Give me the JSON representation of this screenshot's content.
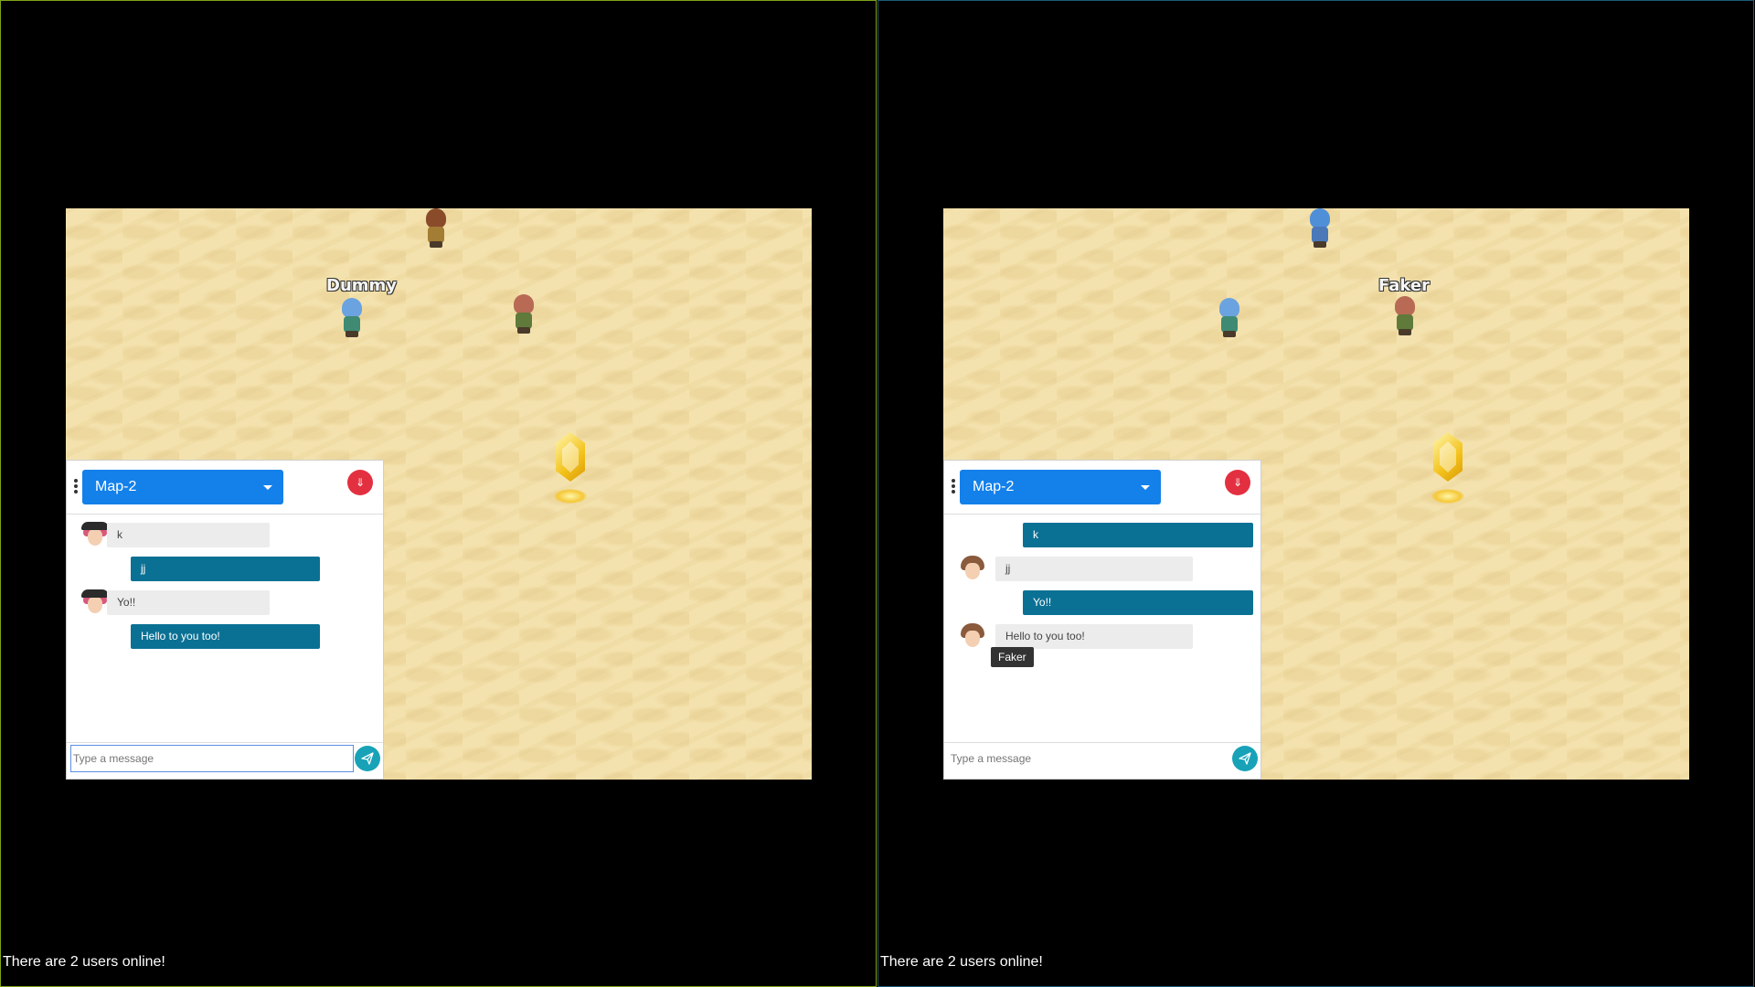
{
  "panes": [
    {
      "id": "left",
      "players": [
        {
          "name": "",
          "sprite": "brown-hair-warrior"
        },
        {
          "name": "Dummy",
          "sprite": "blue-hair-girl"
        },
        {
          "name": "",
          "sprite": "pink-hair-archer"
        }
      ],
      "chat": {
        "room": "Map-2",
        "input_placeholder": "Type a message",
        "messages": [
          {
            "text": "k",
            "direction": "in",
            "avatar": "pink-hair-hat"
          },
          {
            "text": "jj",
            "direction": "out"
          },
          {
            "text": "Yo!!",
            "direction": "in",
            "avatar": "pink-hair-hat"
          },
          {
            "text": "Hello to you too!",
            "direction": "out"
          }
        ],
        "tooltip": ""
      },
      "status": "There are 2 users online!"
    },
    {
      "id": "right",
      "players": [
        {
          "name": "",
          "sprite": "blue-hair-girl"
        },
        {
          "name": "",
          "sprite": "blue-hair-girl"
        },
        {
          "name": "Faker",
          "sprite": "pink-hair-archer"
        }
      ],
      "chat": {
        "room": "Map-2",
        "input_placeholder": "Type a message",
        "messages": [
          {
            "text": "k",
            "direction": "out"
          },
          {
            "text": "jj",
            "direction": "in",
            "avatar": "brown-hair-boy"
          },
          {
            "text": "Yo!!",
            "direction": "out"
          },
          {
            "text": "Hello to you too!",
            "direction": "in",
            "avatar": "brown-hair-boy"
          }
        ],
        "tooltip": "Faker"
      },
      "status": "There are 2 users online!"
    }
  ],
  "colors": {
    "sand": "#f4e2ae",
    "room_select": "#1480ea",
    "collapse": "#e33040",
    "outgoing_bubble": "#0b7194",
    "incoming_bubble": "#ececec",
    "send": "#17a2b8",
    "left_border": "#7fa31a",
    "right_border": "#1c5a78"
  }
}
